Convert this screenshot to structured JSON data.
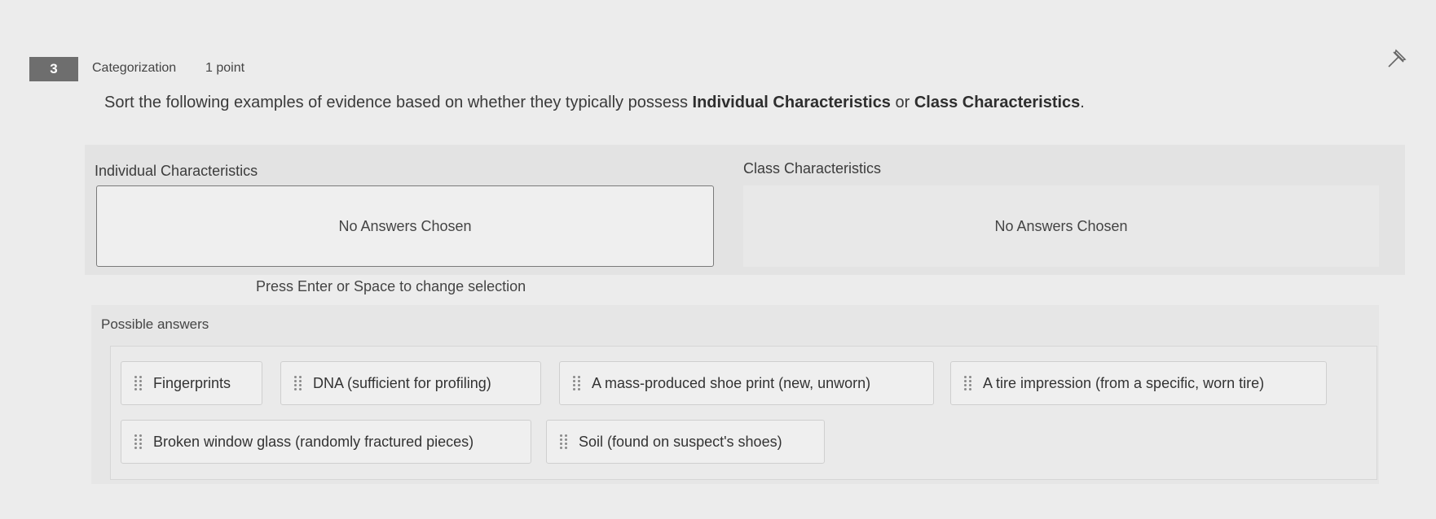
{
  "question": {
    "number": "3",
    "type": "Categorization",
    "points": "1 point",
    "prompt_before": "Sort the following examples of evidence based on whether they typically possess ",
    "bold1": "Individual Characteristics",
    "prompt_middle": " or ",
    "bold2": "Class Characteristics",
    "prompt_after": "."
  },
  "categories": [
    {
      "label": "Individual Characteristics",
      "placeholder": "No Answers Chosen"
    },
    {
      "label": "Class Characteristics",
      "placeholder": "No Answers Chosen"
    }
  ],
  "hint": "Press Enter or Space to change selection",
  "possible_answers": {
    "title": "Possible answers",
    "items": [
      "Fingerprints",
      "DNA (sufficient for profiling)",
      "A mass-produced shoe print (new, unworn)",
      "A tire impression (from a specific, worn tire)",
      "Broken window glass (randomly fractured pieces)",
      "Soil (found on suspect's shoes)"
    ]
  },
  "icons": {
    "pin": "pin-icon",
    "grip": "drag-handle-icon"
  }
}
